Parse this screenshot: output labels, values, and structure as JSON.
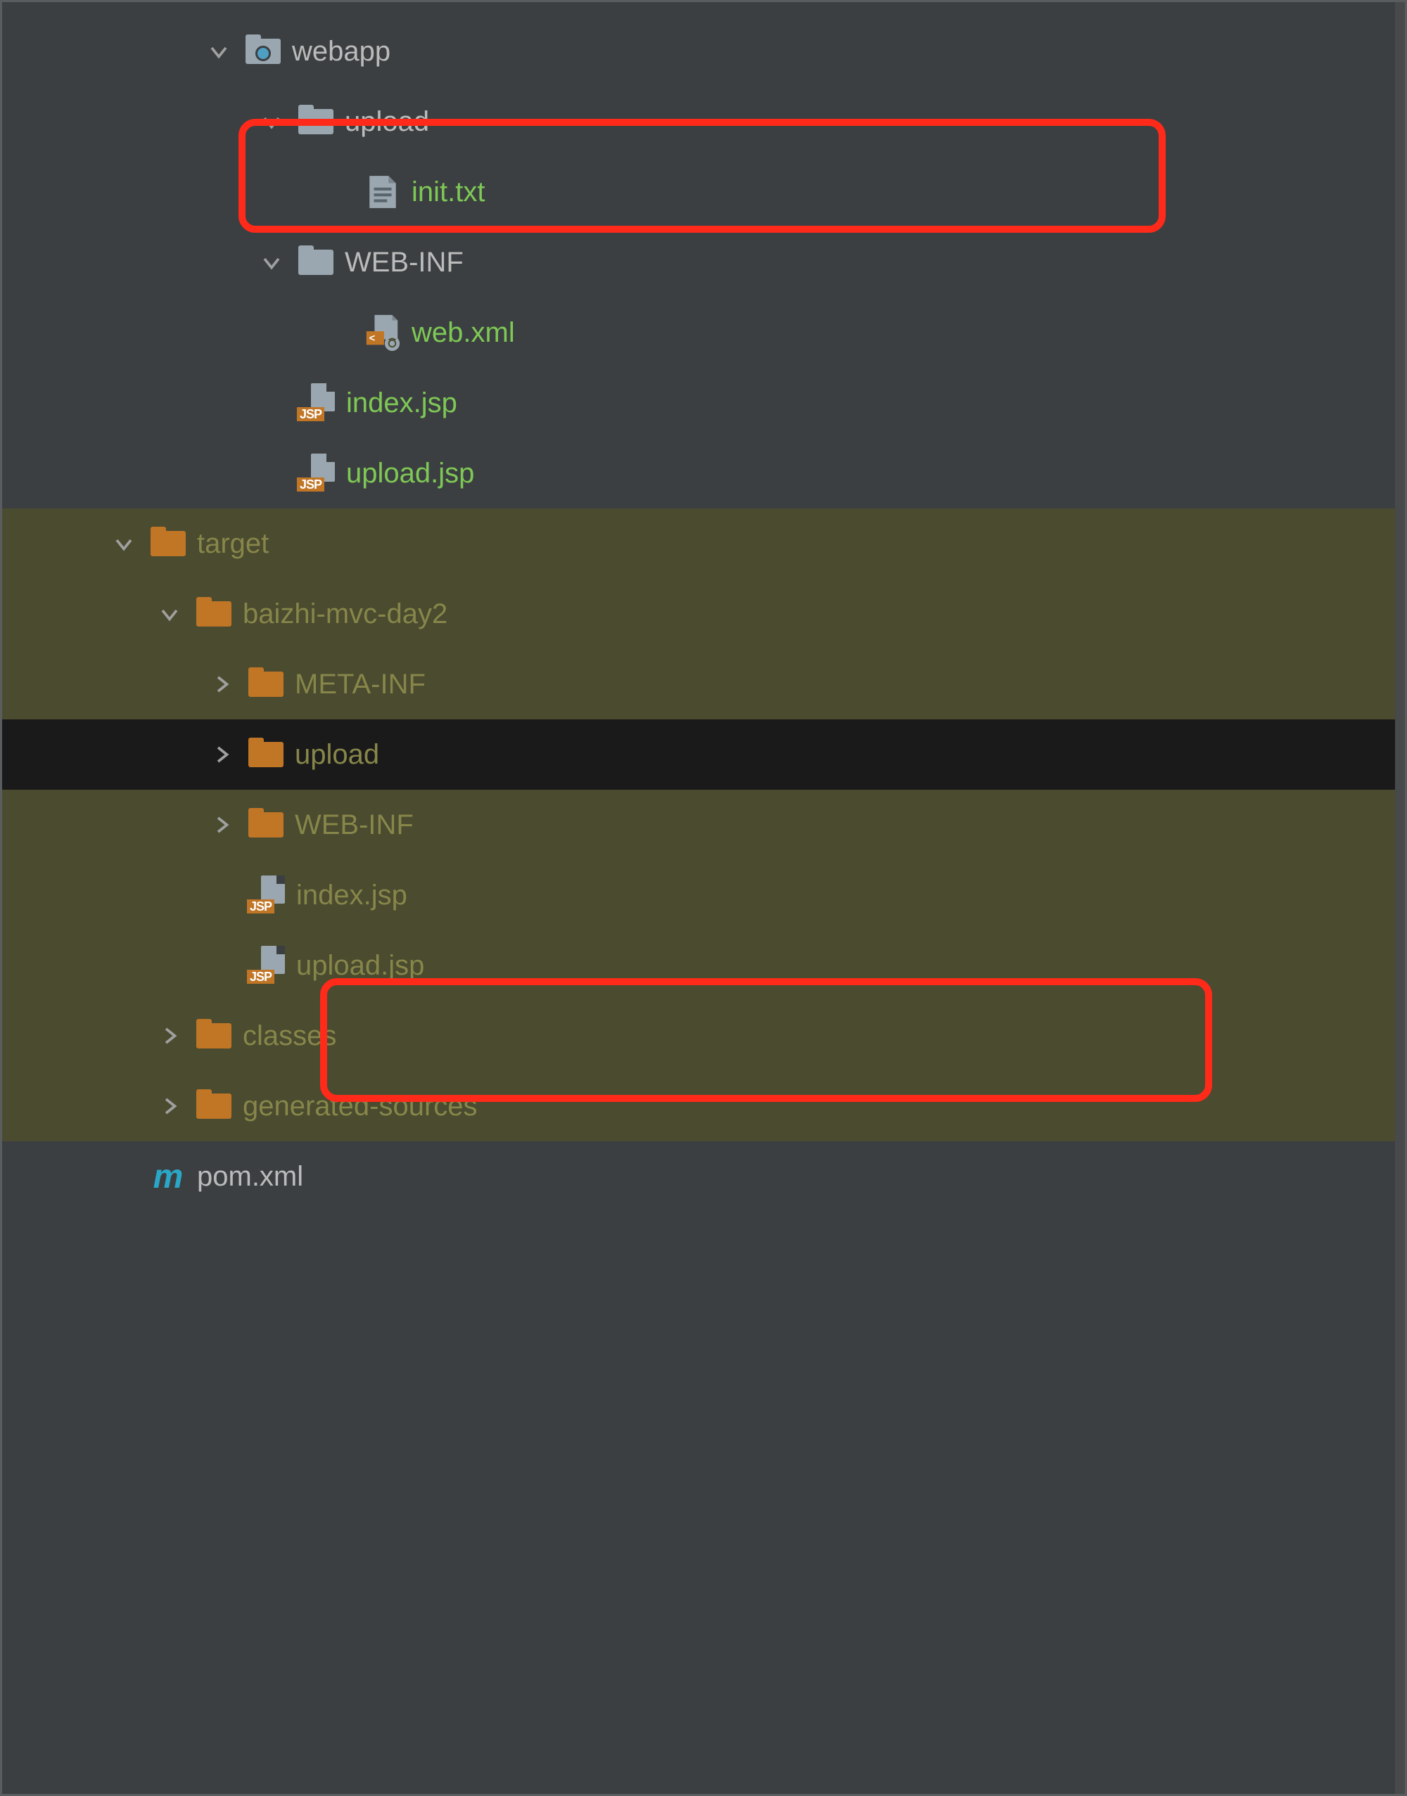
{
  "tree": {
    "webapp": {
      "label": "webapp"
    },
    "upload1": {
      "label": "upload"
    },
    "inittxt": {
      "label": "init.txt"
    },
    "webinf1": {
      "label": "WEB-INF"
    },
    "webxml": {
      "label": "web.xml"
    },
    "indexjsp1": {
      "label": "index.jsp"
    },
    "uploadjsp1": {
      "label": "upload.jsp"
    },
    "target": {
      "label": "target"
    },
    "project": {
      "label": "baizhi-mvc-day2"
    },
    "metainf": {
      "label": "META-INF"
    },
    "upload2": {
      "label": "upload"
    },
    "webinf2": {
      "label": "WEB-INF"
    },
    "indexjsp2": {
      "label": "index.jsp"
    },
    "uploadjsp2": {
      "label": "upload.jsp"
    },
    "classes": {
      "label": "classes"
    },
    "gensrc": {
      "label": "generated-sources"
    },
    "pom": {
      "label": "pom.xml"
    }
  },
  "jsp_badge": "JSP"
}
